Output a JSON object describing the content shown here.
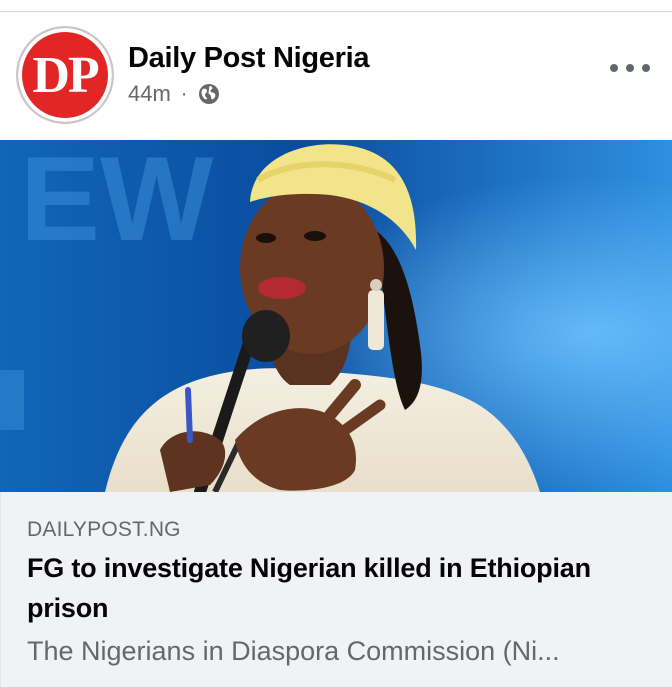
{
  "post": {
    "page_name": "Daily Post Nigeria",
    "avatar_text": "DP",
    "timestamp": "44m",
    "separator": "·",
    "privacy_icon": "globe-icon",
    "more_icon": "more-options-icon"
  },
  "image": {
    "subject": "photo"
  },
  "link_preview": {
    "domain": "DAILYPOST.NG",
    "title": "FG to investigate Nigerian killed in Ethiopian prison",
    "description": "The Nigerians in Diaspora Commission (Ni..."
  },
  "colors": {
    "brand_red": "#e22625",
    "card_bg": "#f0f2f5",
    "secondary_text": "#65676b",
    "primary_text": "#050505"
  }
}
